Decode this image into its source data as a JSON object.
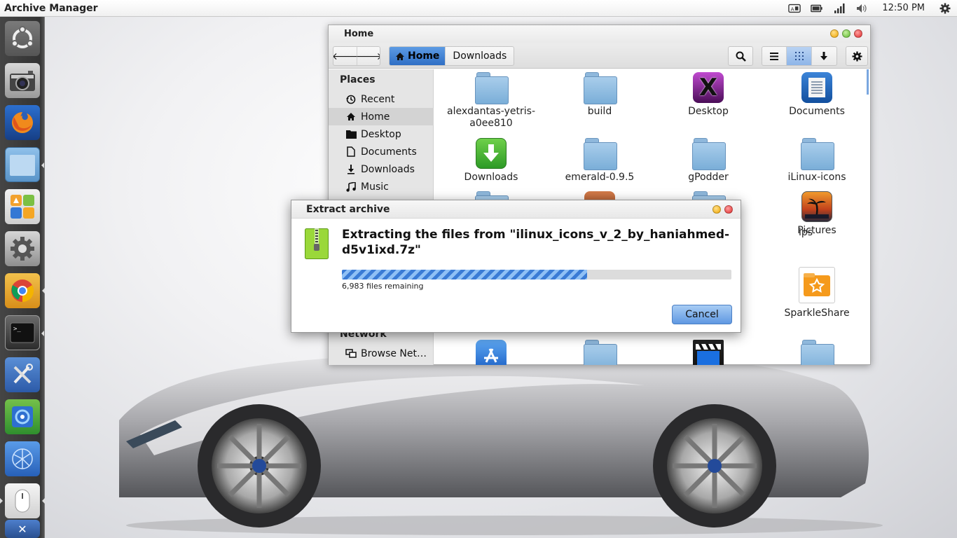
{
  "panel": {
    "app_title": "Archive Manager",
    "clock": "12:50 PM"
  },
  "launcher": {
    "items": [
      "ubuntu-dash",
      "camera",
      "firefox",
      "files",
      "app-center",
      "system-settings",
      "chrome",
      "terminal",
      "tools",
      "screenshot",
      "network",
      "mouse",
      "apps"
    ]
  },
  "file_manager": {
    "title": "Home",
    "breadcrumb": {
      "home": "Home",
      "downloads": "Downloads"
    },
    "sidebar": {
      "places_heading": "Places",
      "network_heading": "Network",
      "items": [
        {
          "label": "Recent",
          "icon": "recent-icon"
        },
        {
          "label": "Home",
          "icon": "home-icon"
        },
        {
          "label": "Desktop",
          "icon": "desktop-icon"
        },
        {
          "label": "Documents",
          "icon": "documents-icon"
        },
        {
          "label": "Downloads",
          "icon": "downloads-icon"
        },
        {
          "label": "Music",
          "icon": "music-icon"
        }
      ],
      "network_items": [
        {
          "label": "Browse Net…",
          "icon": "browse-network-icon"
        }
      ]
    },
    "files": {
      "f1": "alexdantas-yetris-a0ee810",
      "f2": "build",
      "f3": "Desktop",
      "f4": "Documents",
      "f5": "Downloads",
      "f6": "emerald-0.9.5",
      "f7": "gPodder",
      "f8": "iLinux-icons",
      "f9": "ips",
      "f10": "Pictures",
      "f11": "SparkleShare"
    }
  },
  "dialog": {
    "title": "Extract archive",
    "heading": "Extracting the files from \"ilinux_icons_v_2_by_haniahmed-d5v1ixd.7z\"",
    "progress": 0.63,
    "remaining": "6,983 files remaining",
    "cancel_label": "Cancel"
  },
  "colors": {
    "accent": "#3a7bd5",
    "launcher_bg": "#3a3a3a"
  }
}
